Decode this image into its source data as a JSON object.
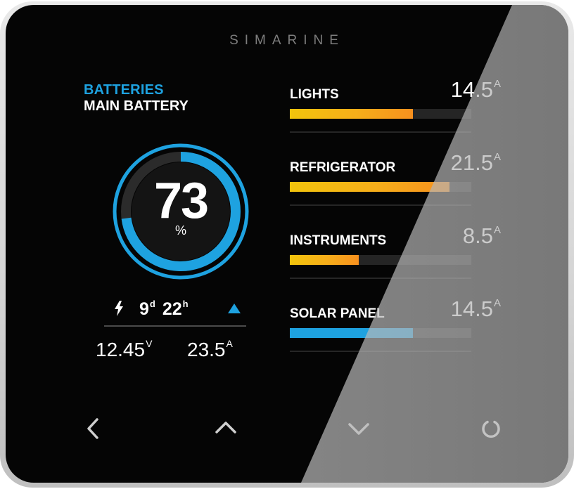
{
  "device": {
    "brand": "SIMARINE"
  },
  "battery": {
    "section_title": "BATTERIES",
    "name": "MAIN BATTERY",
    "charge_percent": 73,
    "charge_value": "73",
    "charge_unit": "%",
    "time_days": "9",
    "time_days_unit": "d",
    "time_hours": "22",
    "time_hours_unit": "h",
    "trend": "charging-up-icon",
    "voltage": "12.45",
    "voltage_unit": "V",
    "current": "23.5",
    "current_unit": "A"
  },
  "loads": [
    {
      "name": "LIGHTS",
      "value": "14.5",
      "unit": "A",
      "level": 0.68,
      "bar_style": "warm"
    },
    {
      "name": "REFRIGERATOR",
      "value": "21.5",
      "unit": "A",
      "level": 0.88,
      "bar_style": "warm"
    },
    {
      "name": "INSTRUMENTS",
      "value": "8.5",
      "unit": "A",
      "level": 0.38,
      "bar_style": "warm"
    },
    {
      "name": "SOLAR PANEL",
      "value": "14.5",
      "unit": "A",
      "level": 0.68,
      "bar_style": "cool"
    }
  ],
  "nav": {
    "buttons": [
      "chevron-left-icon",
      "chevron-up-icon",
      "chevron-down-icon",
      "circle-menu-icon"
    ]
  },
  "colors": {
    "accent_blue": "#1ea2e0",
    "bar_yellow": "#f2c40c",
    "bar_orange": "#f7901e",
    "screen_bg": "#050505"
  }
}
